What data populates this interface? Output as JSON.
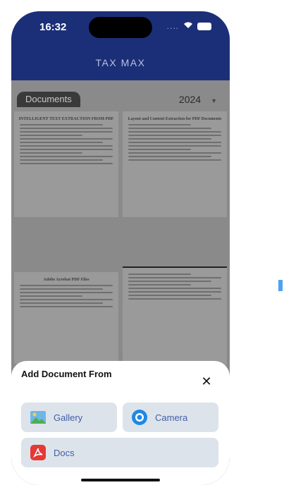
{
  "status_bar": {
    "time": "16:32",
    "signal": "....",
    "icons": [
      "wifi-icon",
      "battery-icon"
    ]
  },
  "appbar": {
    "title": "TAX MAX"
  },
  "filters": {
    "category": "Documents",
    "year": "2024"
  },
  "documents": [
    {
      "title": "INTELLIGENT TEXT EXTRACTION FROM PDF"
    },
    {
      "title": "Layout and Content Extraction for PDF Documents"
    },
    {
      "title": "Adobe Acrobat PDF Files"
    },
    {
      "title": ""
    }
  ],
  "sheet": {
    "title": "Add Document From",
    "options": {
      "gallery": "Gallery",
      "camera": "Camera",
      "docs": "Docs"
    }
  },
  "colors": {
    "primary": "#1b2f78",
    "option_bg": "#dde3ea",
    "option_text": "#3f5fa8"
  }
}
